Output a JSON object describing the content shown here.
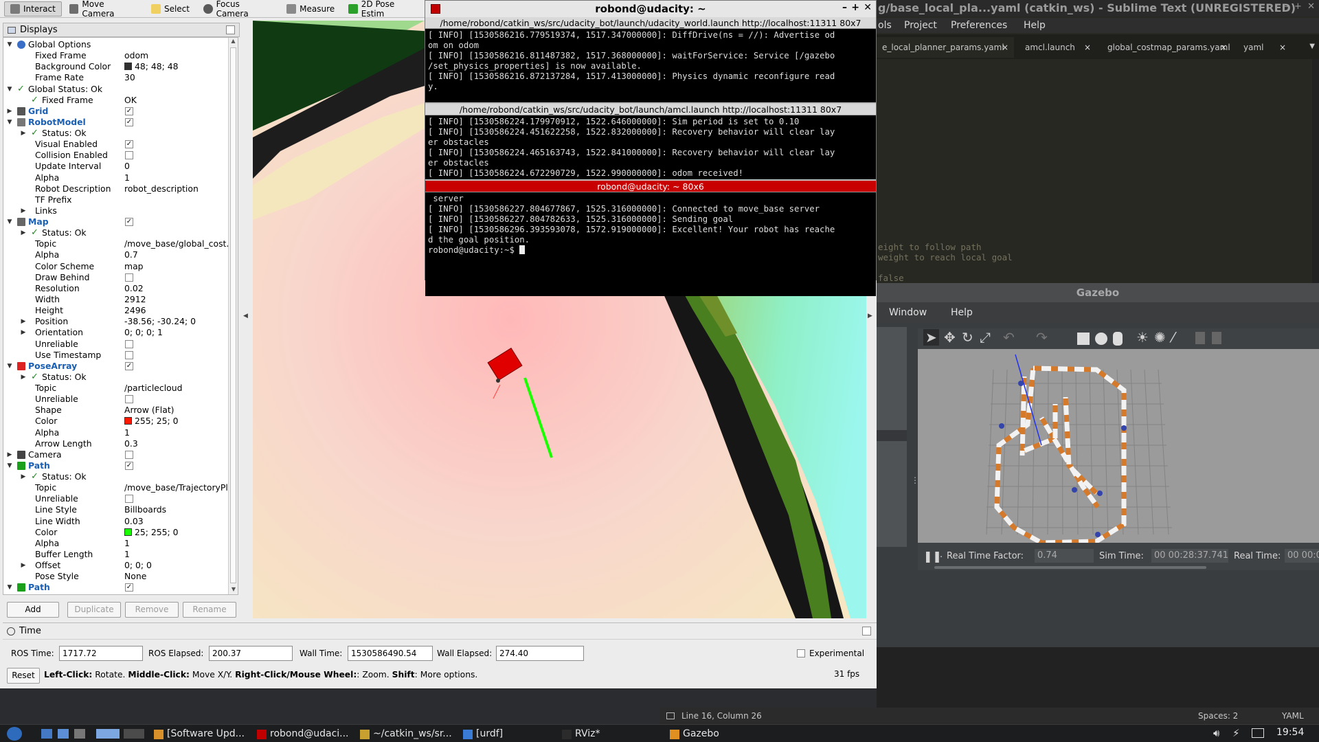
{
  "rviz": {
    "toolbar": [
      {
        "label": "Interact",
        "icon": "cursor-icon",
        "active": true
      },
      {
        "label": "Move Camera",
        "icon": "move-camera-icon"
      },
      {
        "label": "Select",
        "icon": "select-icon"
      },
      {
        "label": "Focus Camera",
        "icon": "focus-camera-icon"
      },
      {
        "label": "Measure",
        "icon": "ruler-icon"
      },
      {
        "label": "2D Pose Estim",
        "icon": "pose-arrow-icon"
      }
    ],
    "displays_title": "Displays",
    "tree": [
      {
        "d": 0,
        "a": "▼",
        "icon": "globe",
        "name": "Global Options",
        "val": ""
      },
      {
        "d": 1,
        "name": "Fixed Frame",
        "val": "odom"
      },
      {
        "d": 1,
        "name": "Background Color",
        "val": "48; 48; 48",
        "swatch": "#303030"
      },
      {
        "d": 1,
        "name": "Frame Rate",
        "val": "30"
      },
      {
        "d": 0,
        "a": "▼",
        "ok": true,
        "name": "Global Status: Ok",
        "val": ""
      },
      {
        "d": 1,
        "ok": true,
        "name": "Fixed Frame",
        "val": "OK"
      },
      {
        "d": 0,
        "a": "▶",
        "icon": "grid",
        "name": "Grid",
        "blue": true,
        "cb": "✓"
      },
      {
        "d": 0,
        "a": "▼",
        "icon": "robot",
        "name": "RobotModel",
        "blue": true,
        "cb": "✓"
      },
      {
        "d": 1,
        "a": "▶",
        "ok": true,
        "name": "Status: Ok",
        "val": ""
      },
      {
        "d": 1,
        "name": "Visual Enabled",
        "cb": "✓"
      },
      {
        "d": 1,
        "name": "Collision Enabled",
        "cb": ""
      },
      {
        "d": 1,
        "name": "Update Interval",
        "val": "0"
      },
      {
        "d": 1,
        "name": "Alpha",
        "val": "1"
      },
      {
        "d": 1,
        "name": "Robot Description",
        "val": "robot_description"
      },
      {
        "d": 1,
        "name": "TF Prefix",
        "val": ""
      },
      {
        "d": 1,
        "a": "▶",
        "name": "Links",
        "val": ""
      },
      {
        "d": 0,
        "a": "▼",
        "icon": "map",
        "name": "Map",
        "blue": true,
        "cb": "✓"
      },
      {
        "d": 1,
        "a": "▶",
        "ok": true,
        "name": "Status: Ok",
        "val": ""
      },
      {
        "d": 1,
        "name": "Topic",
        "val": "/move_base/global_cost.."
      },
      {
        "d": 1,
        "name": "Alpha",
        "val": "0.7"
      },
      {
        "d": 1,
        "name": "Color Scheme",
        "val": "map"
      },
      {
        "d": 1,
        "name": "Draw Behind",
        "cb": ""
      },
      {
        "d": 1,
        "name": "Resolution",
        "val": "0.02"
      },
      {
        "d": 1,
        "name": "Width",
        "val": "2912"
      },
      {
        "d": 1,
        "name": "Height",
        "val": "2496"
      },
      {
        "d": 1,
        "a": "▶",
        "name": "Position",
        "val": "-38.56; -30.24; 0"
      },
      {
        "d": 1,
        "a": "▶",
        "name": "Orientation",
        "val": "0; 0; 0; 1"
      },
      {
        "d": 1,
        "name": "Unreliable",
        "cb": ""
      },
      {
        "d": 1,
        "name": "Use Timestamp",
        "cb": ""
      },
      {
        "d": 0,
        "a": "▼",
        "icon": "posearray",
        "name": "PoseArray",
        "blue": true,
        "cb": "✓"
      },
      {
        "d": 1,
        "a": "▶",
        "ok": true,
        "name": "Status: Ok",
        "val": ""
      },
      {
        "d": 1,
        "name": "Topic",
        "val": "/particlecloud"
      },
      {
        "d": 1,
        "name": "Unreliable",
        "cb": ""
      },
      {
        "d": 1,
        "name": "Shape",
        "val": "Arrow (Flat)"
      },
      {
        "d": 1,
        "name": "Color",
        "val": "255; 25; 0",
        "swatch": "#ff1900"
      },
      {
        "d": 1,
        "name": "Alpha",
        "val": "1"
      },
      {
        "d": 1,
        "name": "Arrow Length",
        "val": "0.3"
      },
      {
        "d": 0,
        "a": "▶",
        "icon": "camera",
        "name": "Camera",
        "cb": ""
      },
      {
        "d": 0,
        "a": "▼",
        "icon": "path",
        "name": "Path",
        "blue": true,
        "cb": "✓"
      },
      {
        "d": 1,
        "a": "▶",
        "ok": true,
        "name": "Status: Ok",
        "val": ""
      },
      {
        "d": 1,
        "name": "Topic",
        "val": "/move_base/TrajectoryPl.."
      },
      {
        "d": 1,
        "name": "Unreliable",
        "cb": ""
      },
      {
        "d": 1,
        "name": "Line Style",
        "val": "Billboards"
      },
      {
        "d": 1,
        "name": "Line Width",
        "val": "0.03"
      },
      {
        "d": 1,
        "name": "Color",
        "val": "25; 255; 0",
        "swatch": "#19ff00"
      },
      {
        "d": 1,
        "name": "Alpha",
        "val": "1"
      },
      {
        "d": 1,
        "name": "Buffer Length",
        "val": "1"
      },
      {
        "d": 1,
        "a": "▶",
        "name": "Offset",
        "val": "0; 0; 0"
      },
      {
        "d": 1,
        "name": "Pose Style",
        "val": "None"
      },
      {
        "d": 0,
        "a": "▼",
        "icon": "path",
        "name": "Path",
        "blue": true,
        "cb": "✓"
      },
      {
        "d": 1,
        "a": "▶",
        "ok": true,
        "name": "Status: Ok",
        "val": ""
      }
    ],
    "buttons": {
      "add": "Add",
      "duplicate": "Duplicate",
      "remove": "Remove",
      "rename": "Rename"
    },
    "time": {
      "title": "Time",
      "ros_time_label": "ROS Time:",
      "ros_time": "1717.72",
      "ros_elapsed_label": "ROS Elapsed:",
      "ros_elapsed": "200.37",
      "wall_time_label": "Wall Time:",
      "wall_time": "1530586490.54",
      "wall_elapsed_label": "Wall Elapsed:",
      "wall_elapsed": "274.40",
      "experimental": "Experimental",
      "reset": "Reset",
      "fps": "31 fps"
    },
    "help": [
      {
        "b": "Left-Click:",
        "t": " Rotate. "
      },
      {
        "b": "Middle-Click:",
        "t": " Move X/Y. "
      },
      {
        "b": "Right-Click/Mouse Wheel:",
        "t": ": Zoom. "
      },
      {
        "b": "Shift",
        "t": ": More options."
      }
    ]
  },
  "terminal": {
    "window_title": "robond@udacity: ~",
    "panes": [
      {
        "title": "/home/robond/catkin_ws/src/udacity_bot/launch/udacity_world.launch http://localhost:11311 80x7",
        "lines": [
          "[ INFO] [1530586216.779519374, 1517.347000000]: DiffDrive(ns = //): Advertise od",
          "om on odom",
          "[ INFO] [1530586216.811487382, 1517.368000000]: waitForService: Service [/gazebo",
          "/set_physics_properties] is now available.",
          "[ INFO] [1530586216.872137284, 1517.413000000]: Physics dynamic reconfigure read",
          "y.",
          ""
        ]
      },
      {
        "title": "/home/robond/catkin_ws/src/udacity_bot/launch/amcl.launch http://localhost:11311 80x7",
        "lines": [
          "[ INFO] [1530586224.179970912, 1522.646000000]: Sim period is set to 0.10",
          "[ INFO] [1530586224.451622258, 1522.832000000]: Recovery behavior will clear lay",
          "er obstacles",
          "[ INFO] [1530586224.465163743, 1522.841000000]: Recovery behavior will clear lay",
          "er obstacles",
          "[ INFO] [1530586224.672290729, 1522.990000000]: odom received!",
          ""
        ]
      },
      {
        "title": "robond@udacity: ~ 80x6",
        "lines": [
          " server",
          "[ INFO] [1530586227.804677867, 1525.316000000]: Connected to move_base server",
          "[ INFO] [1530586227.804782633, 1525.316000000]: Sending goal",
          "[ INFO] [1530586296.393593078, 1572.919000000]: Excellent! Your robot has reache",
          "d the goal position.",
          "robond@udacity:~$ "
        ]
      }
    ]
  },
  "sublime": {
    "title": "g/base_local_pla...yaml (catkin_ws) - Sublime Text (UNREGISTERED)",
    "menu": [
      "ols",
      "Project",
      "Preferences",
      "Help"
    ],
    "tabs": [
      "e_local_planner_params.yaml",
      "amcl.launch",
      "global_costmap_params.yaml",
      "yaml"
    ],
    "code": [
      "eight to follow path",
      "weight to reach local goal",
      "",
      "false"
    ],
    "status": {
      "position": "Line 16, Column 26",
      "spaces": "Spaces: 2",
      "syntax": "YAML"
    }
  },
  "gazebo": {
    "title": "Gazebo",
    "menu": [
      "Window",
      "Help"
    ],
    "rtf_label": "Real Time Factor:",
    "rtf": "0.74",
    "sim_label": "Sim Time:",
    "sim": "00 00:28:37.741",
    "real_label": "Real Time:",
    "real": "00 00:0"
  },
  "taskbar": {
    "tasks": [
      "[Software Upd...",
      "robond@udaci...",
      "~/catkin_ws/sr...",
      "[urdf]",
      "RViz*",
      "Gazebo"
    ],
    "clock": "19:54"
  }
}
